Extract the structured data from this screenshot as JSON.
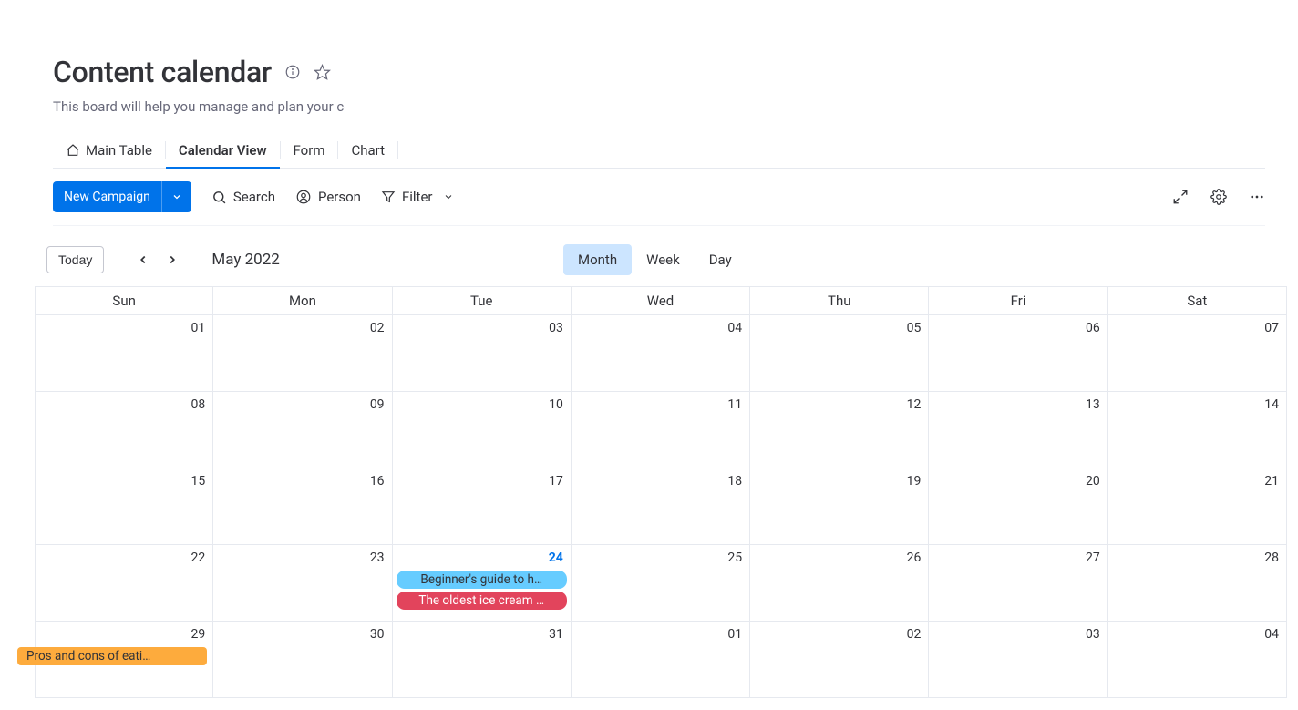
{
  "header": {
    "title": "Content calendar",
    "subtitle": "This board will help you manage and plan your conte"
  },
  "tabs": [
    {
      "label": "Main Table",
      "icon": "home-icon",
      "active": false
    },
    {
      "label": "Calendar View",
      "icon": null,
      "active": true
    },
    {
      "label": "Form",
      "icon": null,
      "active": false
    },
    {
      "label": "Chart",
      "icon": null,
      "active": false
    }
  ],
  "toolbar": {
    "new_button": "New Campaign",
    "search": "Search",
    "person": "Person",
    "filter": "Filter"
  },
  "calendar_nav": {
    "today": "Today",
    "month_label": "May 2022",
    "views": {
      "month": "Month",
      "week": "Week",
      "day": "Day"
    },
    "active_view": "month"
  },
  "day_headers": [
    "Sun",
    "Mon",
    "Tue",
    "Wed",
    "Thu",
    "Fri",
    "Sat"
  ],
  "weeks": [
    [
      {
        "n": "01"
      },
      {
        "n": "02"
      },
      {
        "n": "03"
      },
      {
        "n": "04"
      },
      {
        "n": "05"
      },
      {
        "n": "06"
      },
      {
        "n": "07"
      }
    ],
    [
      {
        "n": "08"
      },
      {
        "n": "09"
      },
      {
        "n": "10"
      },
      {
        "n": "11"
      },
      {
        "n": "12"
      },
      {
        "n": "13"
      },
      {
        "n": "14"
      }
    ],
    [
      {
        "n": "15"
      },
      {
        "n": "16"
      },
      {
        "n": "17"
      },
      {
        "n": "18"
      },
      {
        "n": "19"
      },
      {
        "n": "20"
      },
      {
        "n": "21"
      }
    ],
    [
      {
        "n": "22"
      },
      {
        "n": "23"
      },
      {
        "n": "24",
        "today": true,
        "events": [
          {
            "t": "Beginner's guide to h…",
            "c": "blue"
          },
          {
            "t": "The oldest ice cream …",
            "c": "pink"
          }
        ]
      },
      {
        "n": "25"
      },
      {
        "n": "26"
      },
      {
        "n": "27"
      },
      {
        "n": "28"
      }
    ],
    [
      {
        "n": "29",
        "events": [
          {
            "t": "Pros and cons of eati…",
            "c": "orange"
          }
        ]
      },
      {
        "n": "30"
      },
      {
        "n": "31"
      },
      {
        "n": "01"
      },
      {
        "n": "02"
      },
      {
        "n": "03"
      },
      {
        "n": "04"
      }
    ]
  ]
}
